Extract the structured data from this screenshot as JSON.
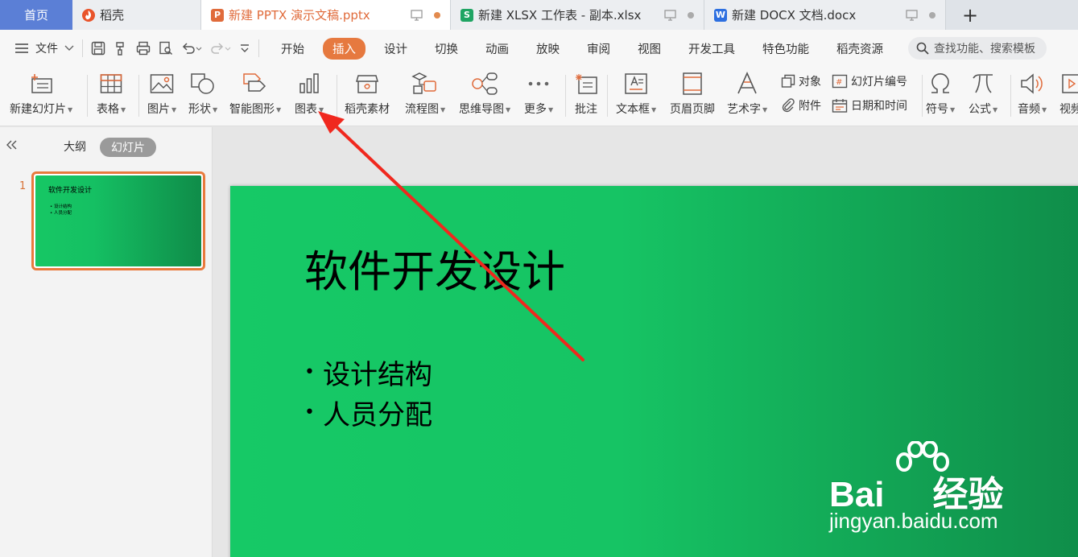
{
  "tabs": [
    {
      "label": "首页"
    },
    {
      "label": "稻壳"
    },
    {
      "label": "新建 PPTX 演示文稿.pptx"
    },
    {
      "label": "新建 XLSX 工作表 - 副本.xlsx"
    },
    {
      "label": "新建 DOCX 文档.docx"
    }
  ],
  "file_icons": {
    "ppt": "P",
    "xls": "S",
    "doc": "W"
  },
  "add_tab": "+",
  "menu": {
    "file_label": "文件",
    "tabs": [
      "开始",
      "插入",
      "设计",
      "切换",
      "动画",
      "放映",
      "审阅",
      "视图",
      "开发工具",
      "特色功能",
      "稻壳资源"
    ],
    "active_tab": "插入",
    "search_placeholder": "查找功能、搜索模板"
  },
  "ribbon": {
    "new_slide": "新建幻灯片",
    "table": "表格",
    "picture": "图片",
    "shape": "形状",
    "smart_art": "智能图形",
    "chart": "图表",
    "daoke_material": "稻壳素材",
    "flowchart": "流程图",
    "mindmap": "思维导图",
    "more": "更多",
    "comment": "批注",
    "textbox": "文本框",
    "header_footer": "页眉页脚",
    "wordart": "艺术字",
    "object": "对象",
    "attachment": "附件",
    "slide_number": "幻灯片编号",
    "date_time": "日期和时间",
    "symbol": "符号",
    "formula": "公式",
    "audio": "音频",
    "video": "视频"
  },
  "left_panel": {
    "outline_tab": "大纲",
    "slides_tab": "幻灯片",
    "slide_number": "1",
    "thumb_title": "软件开发设计",
    "thumb_bullets": [
      "• 设计结构",
      "• 人员分配"
    ]
  },
  "slide": {
    "title": "软件开发设计",
    "bullets": [
      "设计结构",
      "人员分配"
    ]
  },
  "watermark": {
    "brand": "Bai",
    "brand_suffix": "经验",
    "url": "jingyan.baidu.com"
  },
  "colors": {
    "accent": "#e6793f",
    "slide_green": "#16c966",
    "slide_green_dark": "#0f8c49",
    "home_tab": "#5b7fd6",
    "annotation_arrow": "#f0281e"
  }
}
